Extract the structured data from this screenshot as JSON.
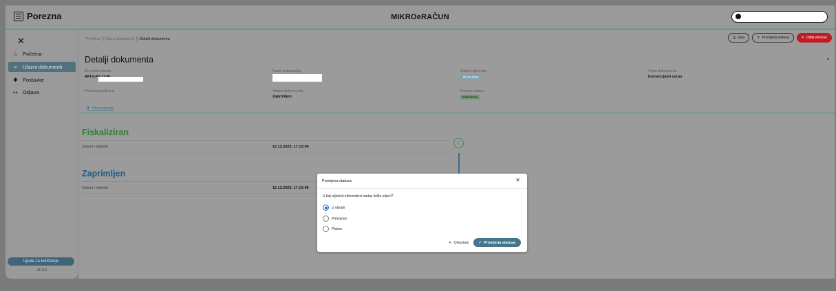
{
  "header": {
    "logo": "Porezna",
    "app_title": "MIKROeRAČUN"
  },
  "sidebar": {
    "items": [
      {
        "label": "Početna"
      },
      {
        "label": "Ulazni dokumenti"
      },
      {
        "label": "Postavke"
      },
      {
        "label": "Odjava"
      }
    ],
    "help_button": "Upute za korištenje",
    "version": "v1.0.0"
  },
  "breadcrumb": {
    "home": "Početna",
    "section": "Ulazni dokumenti",
    "current": "Detalji dokumenta"
  },
  "actions": {
    "print": "Ispis",
    "change_status": "Promjena statusa",
    "reject": "Odbij eRačun"
  },
  "page_title": "Detalji dokumenta",
  "fields": {
    "doc_number_label": "Broj dokumenta",
    "doc_number_value": "API-5-P1-11-FI",
    "sender_label": "Naziv izdavatelja",
    "delivery_date_label": "Datum isporuke",
    "delivery_date_value": "01.02.2025",
    "doc_type_label": "Vrsta dokumenta",
    "doc_type_value": "Komercijalni račun",
    "business_unit_label": "Poslovna jedinica",
    "doc_status_label": "Status dokumenta",
    "doc_status_value": "Zaprimljen",
    "tax_status_label": "Porezni status",
    "tax_status_value": "Fiskaliziran"
  },
  "details_link": "Otvori detalje",
  "history": [
    {
      "title": "Fiskaliziran",
      "row_label": "Datum i vrijeme:",
      "row_value": "12.12.2025. 17:13:08",
      "color": "#2e7d32"
    },
    {
      "title": "Zaprimljen",
      "row_label": "Datum i vrijeme:",
      "row_value": "12.12.2025. 17:13:08",
      "color": "#1f5a82"
    }
  ],
  "modal": {
    "title": "Promjena statusa",
    "question": "U koji sljedeći informativni status želite prijeći?",
    "options": [
      {
        "label": "U obradi",
        "selected": true
      },
      {
        "label": "Prihvaćen",
        "selected": false
      },
      {
        "label": "Plaćen",
        "selected": false
      }
    ],
    "cancel": "Odustani",
    "confirm": "Promjena statusa"
  },
  "colors": {
    "accent": "#43768d",
    "danger": "#c11a23",
    "selected_radio": "#1f66c8"
  }
}
